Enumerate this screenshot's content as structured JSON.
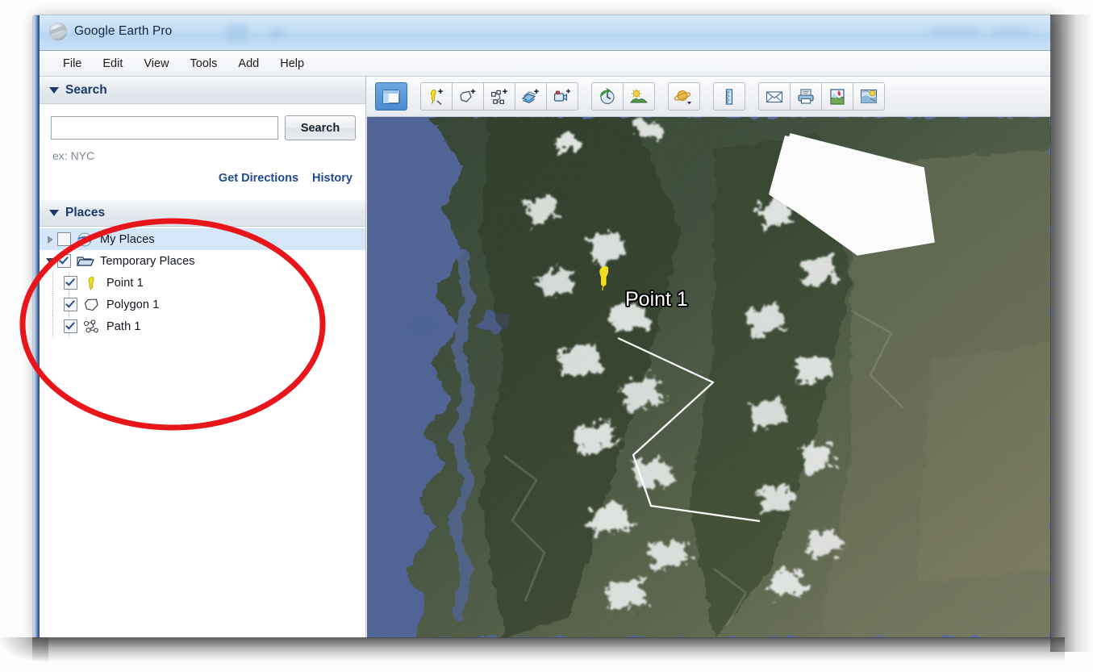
{
  "window": {
    "app_title": "Google Earth Pro",
    "logo_icon": "google-earth-globe-icon"
  },
  "menubar": {
    "items": [
      {
        "label": "File"
      },
      {
        "label": "Edit"
      },
      {
        "label": "View"
      },
      {
        "label": "Tools"
      },
      {
        "label": "Add"
      },
      {
        "label": "Help"
      }
    ]
  },
  "sidebar": {
    "search_panel": {
      "title": "Search",
      "disclosure_icon": "triangle-down-icon",
      "input_value": "",
      "input_placeholder": "",
      "button_label": "Search",
      "hint": "ex: NYC",
      "links": [
        {
          "label": "Get Directions"
        },
        {
          "label": "History"
        }
      ]
    },
    "places_panel": {
      "title": "Places",
      "disclosure_icon": "triangle-down-icon",
      "tree": [
        {
          "label": "My Places",
          "icon": "google-earth-globe-icon",
          "checked": false,
          "expanded": false,
          "selected": true,
          "level": 0
        },
        {
          "label": "Temporary Places",
          "icon": "open-folder-icon",
          "checked": true,
          "expanded": true,
          "selected": false,
          "level": 0
        },
        {
          "label": "Point 1",
          "icon": "yellow-pushpin-icon",
          "checked": true,
          "level": 1
        },
        {
          "label": "Polygon 1",
          "icon": "polygon-icon",
          "checked": true,
          "level": 1
        },
        {
          "label": "Path 1",
          "icon": "path-icon",
          "checked": true,
          "level": 1
        }
      ]
    }
  },
  "toolbar": {
    "groups": [
      {
        "buttons": [
          {
            "icon": "show-sidebar-icon",
            "active": true
          }
        ]
      },
      {
        "buttons": [
          {
            "icon": "add-placemark-icon",
            "active": false
          },
          {
            "icon": "add-polygon-icon",
            "active": false
          },
          {
            "icon": "add-path-icon",
            "active": false
          },
          {
            "icon": "add-image-overlay-icon",
            "active": false
          },
          {
            "icon": "record-tour-icon",
            "active": false
          }
        ]
      },
      {
        "buttons": [
          {
            "icon": "historical-imagery-clock-icon",
            "active": false
          },
          {
            "icon": "sunlight-icon",
            "active": false
          }
        ]
      },
      {
        "buttons": [
          {
            "icon": "planet-switch-icon",
            "active": false
          }
        ]
      },
      {
        "buttons": [
          {
            "icon": "ruler-icon",
            "active": false
          }
        ]
      },
      {
        "buttons": [
          {
            "icon": "email-icon",
            "active": false
          },
          {
            "icon": "print-icon",
            "active": false
          },
          {
            "icon": "save-image-icon",
            "active": false
          },
          {
            "icon": "view-in-maps-icon",
            "active": false
          }
        ]
      }
    ]
  },
  "map": {
    "point_label": "Point 1",
    "features": {
      "placemark": {
        "name": "Point 1",
        "color": "#f5e13c"
      },
      "polygon": {
        "name": "Polygon 1",
        "fill_color": "#ffffff",
        "outline_color": "#ffffff"
      },
      "path": {
        "name": "Path 1",
        "stroke_color": "#ffffff"
      }
    }
  },
  "annotation": {
    "shape": "red-ellipse-highlight",
    "color": "#e8161b"
  },
  "colors": {
    "accent_blue": "#1b3a6b",
    "link_blue": "#1f4b8e",
    "selection_blue": "#d4e6f8",
    "annotation_red": "#e8161b",
    "placemark_yellow": "#f5e13c"
  }
}
